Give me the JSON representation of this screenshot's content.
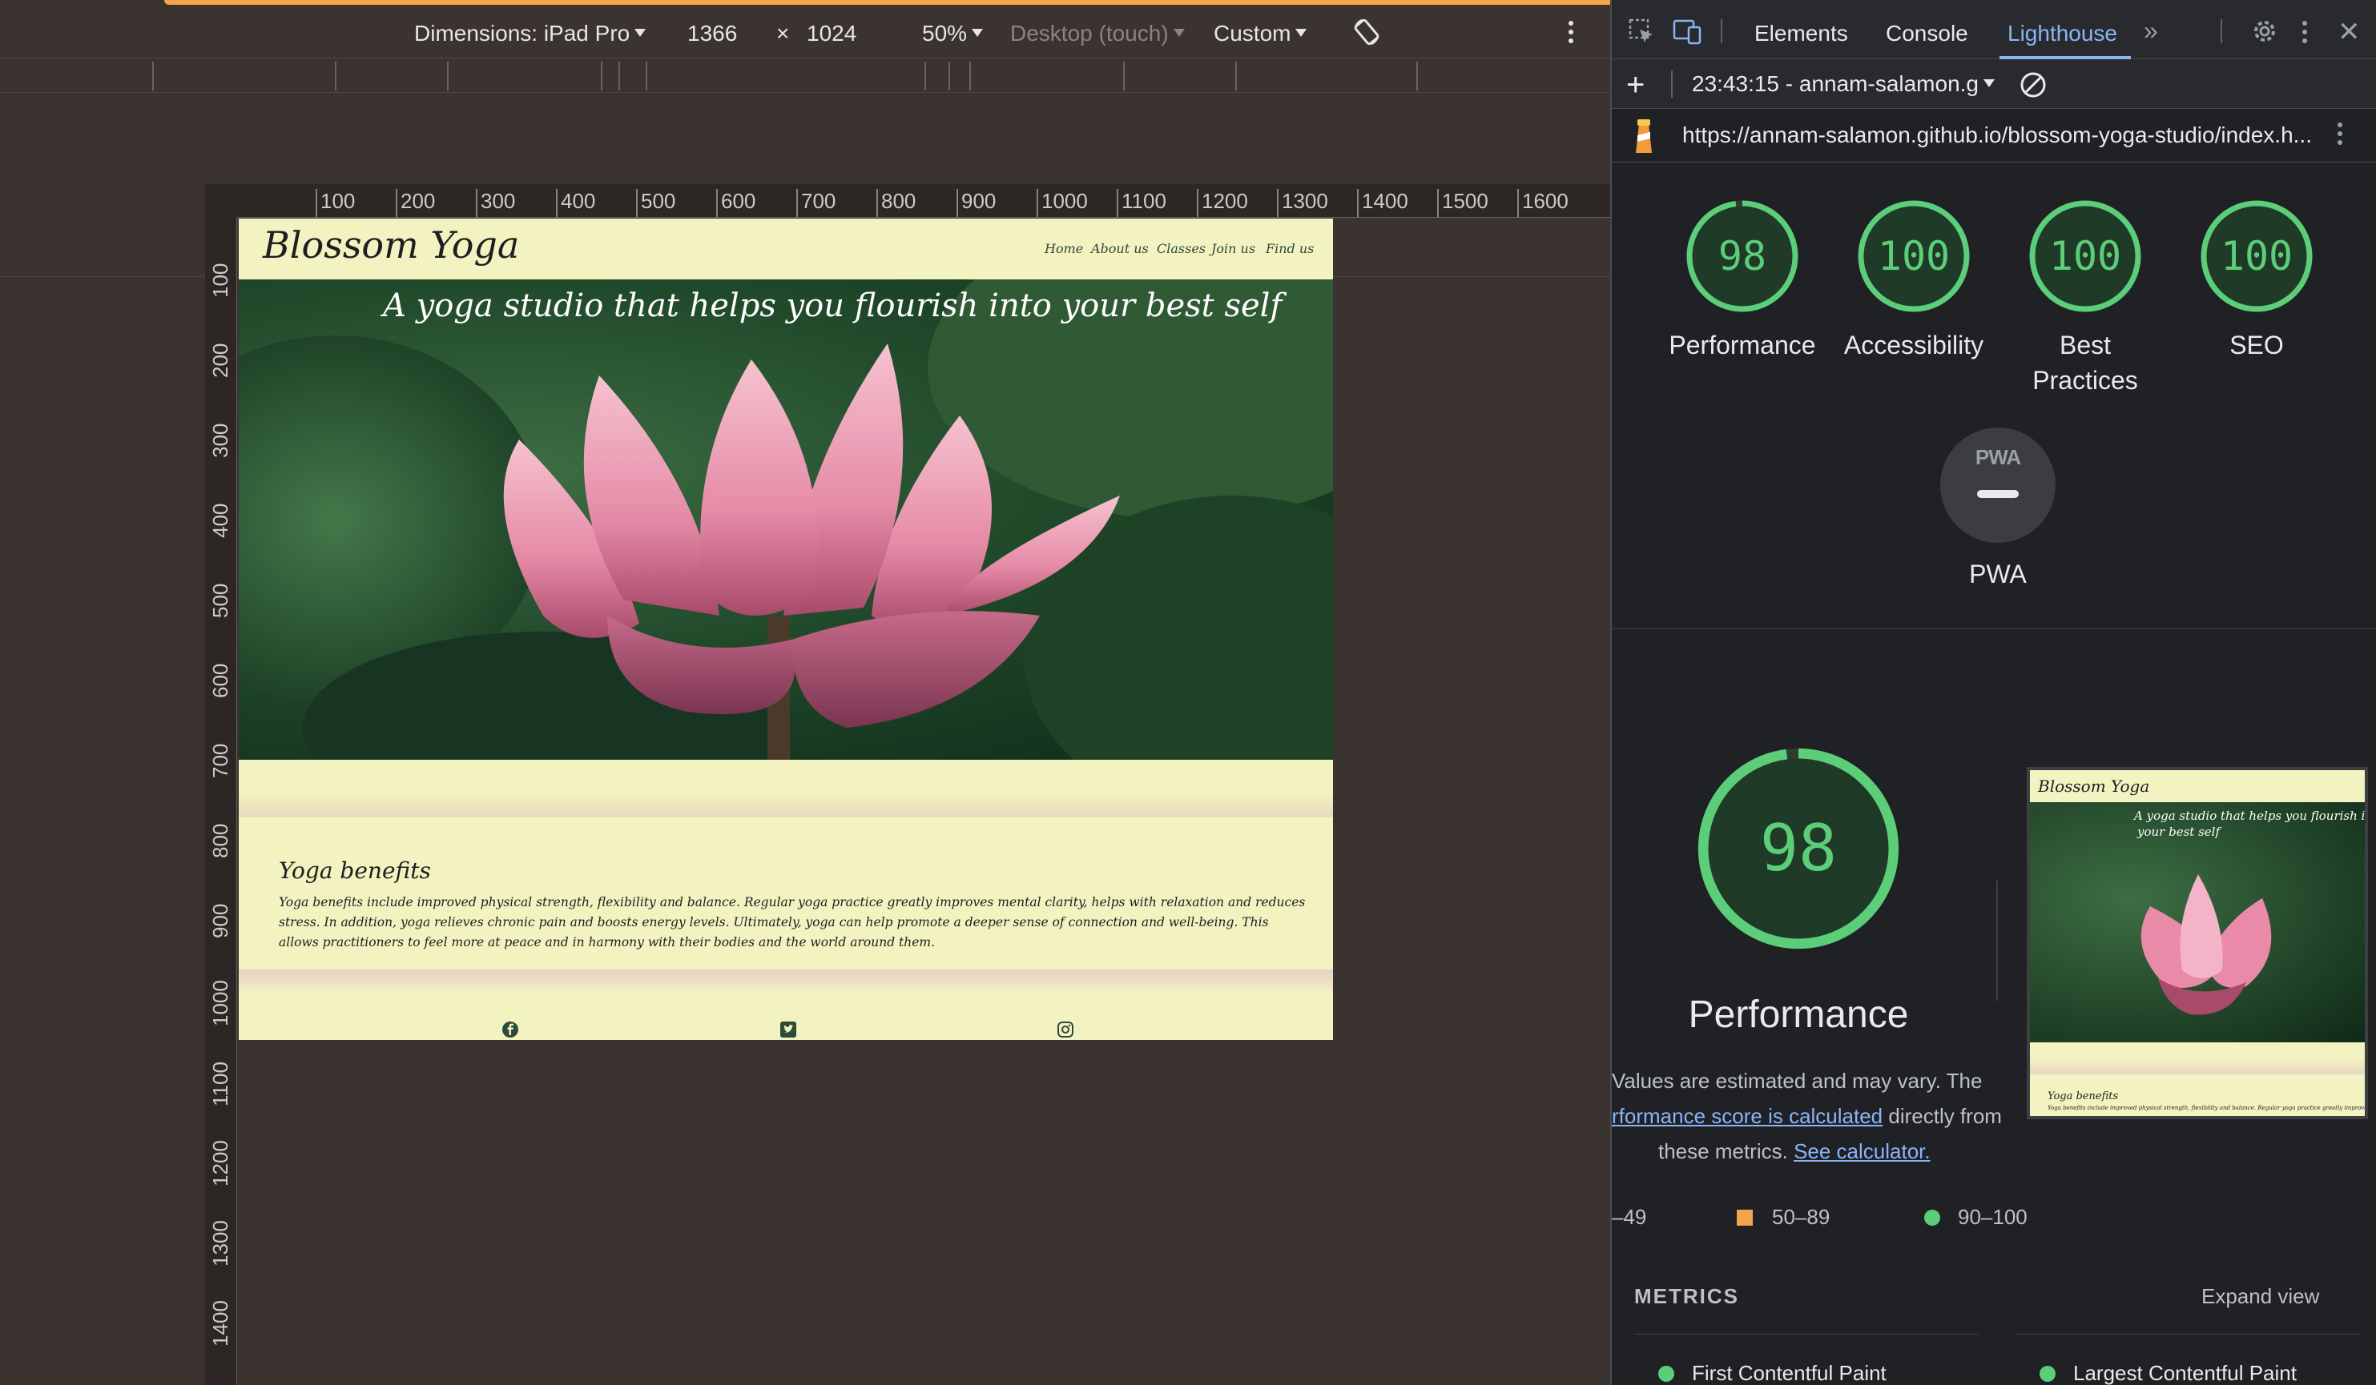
{
  "device_toolbar": {
    "dimensions_label": "Dimensions: iPad Pro",
    "width": "1366",
    "times": "×",
    "height": "1024",
    "zoom": "50%",
    "device_type": "Desktop (touch)",
    "throttle": "Custom"
  },
  "ruler": {
    "h_labels": [
      "100",
      "200",
      "300",
      "400",
      "500",
      "600",
      "700",
      "800",
      "900",
      "1000",
      "1100",
      "1200",
      "1300",
      "1400",
      "1500",
      "1600"
    ],
    "v_labels": [
      "100",
      "200",
      "300",
      "400",
      "500",
      "600",
      "700",
      "800",
      "900",
      "1000",
      "1100",
      "1200",
      "1300",
      "1400"
    ]
  },
  "site": {
    "logo": "Blossom Yoga",
    "nav": [
      "Home",
      "About us",
      "Classes",
      "Join us",
      "Find us"
    ],
    "tagline": "A yoga studio that helps you flourish into your best self",
    "benefits_title": "Yoga benefits",
    "benefits_text": "Yoga benefits include improved physical strength, flexibility and balance. Regular yoga practice greatly improves mental clarity, helps with relaxation and reduces stress. In addition, yoga relieves chronic pain and boosts energy levels. Ultimately, yoga can help promote a deeper sense of connection and well-being. This allows practitioners to feel more at peace and in harmony with their bodies and the world around them.",
    "social_icons": [
      "facebook-icon",
      "twitter-icon",
      "instagram-icon"
    ]
  },
  "devtools": {
    "tabs": [
      "Elements",
      "Console",
      "Lighthouse"
    ],
    "active_tab": "Lighthouse",
    "report_label": "23:43:15 - annam-salamon.g",
    "url": "https://annam-salamon.github.io/blossom-yoga-studio/index.h...",
    "scores": [
      {
        "label": "Performance",
        "value": "98",
        "score": 98
      },
      {
        "label": "Accessibility",
        "value": "100",
        "score": 100
      },
      {
        "label": "Best",
        "label2": "Practices",
        "value": "100",
        "score": 100
      },
      {
        "label": "SEO",
        "value": "100",
        "score": 100
      }
    ],
    "pwa_badge": "PWA",
    "pwa_label": "PWA",
    "perf_big_value": "98",
    "perf_big_score": 98,
    "perf_title": "Performance",
    "note_line1": "Values are estimated and may vary. The",
    "note_link1": "rformance score is calculated",
    "note_line2_suffix": "directly from",
    "note_line3": "these metrics.",
    "note_link2": "See calculator.",
    "thumb_logo": "Blossom Yoga",
    "thumb_tagline1": "A yoga studio that helps you flourish i",
    "thumb_tagline2": "your best self",
    "thumb_benefits": "Yoga benefits",
    "thumb_text": "Yoga benefits include improved physical strength, flexibility and balance. Regular yoga practice greatly improves",
    "legend": {
      "low": "–49",
      "mid": "50–89",
      "high": "90–100"
    },
    "metrics_header": "METRICS",
    "expand_view": "Expand view",
    "metric_1": "First Contentful Paint",
    "metric_2": "Largest Contentful Paint",
    "colors": {
      "pass": "#5ccd78",
      "average": "#f2a64b",
      "accent": "#8ab4f8"
    }
  }
}
